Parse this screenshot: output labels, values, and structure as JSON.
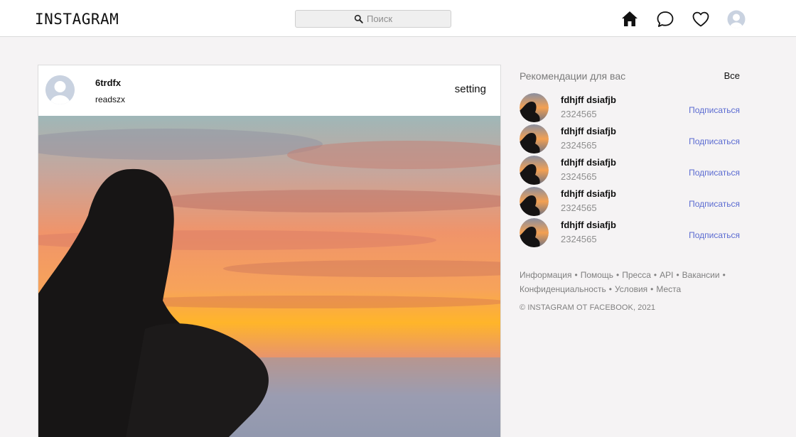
{
  "header": {
    "logo": "INSTAGRAM",
    "search_placeholder": "Поиск",
    "icons": [
      "home-icon",
      "messages-icon",
      "heart-icon",
      "profile-avatar"
    ]
  },
  "post": {
    "username": "6trdfx",
    "subtitle": "readszx",
    "setting_label": "setting",
    "image": "sunset-silhouette-photo"
  },
  "sidebar": {
    "title": "Рекомендации для вас",
    "all_label": "Все",
    "suggestions": [
      {
        "name": "fdhjff dsiafjb",
        "count": "2324565",
        "action": "Подписаться"
      },
      {
        "name": "fdhjff dsiafjb",
        "count": "2324565",
        "action": "Подписаться"
      },
      {
        "name": "fdhjff dsiafjb",
        "count": "2324565",
        "action": "Подписаться"
      },
      {
        "name": "fdhjff dsiafjb",
        "count": "2324565",
        "action": "Подписаться"
      },
      {
        "name": "fdhjff dsiafjb",
        "count": "2324565",
        "action": "Подписаться"
      }
    ],
    "footer_links": [
      "Информация",
      "Помощь",
      "Пресса",
      "API",
      "Вакансии",
      "Конфиденциальность",
      "Условия",
      "Места"
    ],
    "copyright": "© INSTAGRAM ОТ FACEBOOK, 2021"
  },
  "colors": {
    "background": "#f5f3f4",
    "follow_link": "#5b6bd1",
    "border": "#dbdbdb"
  }
}
